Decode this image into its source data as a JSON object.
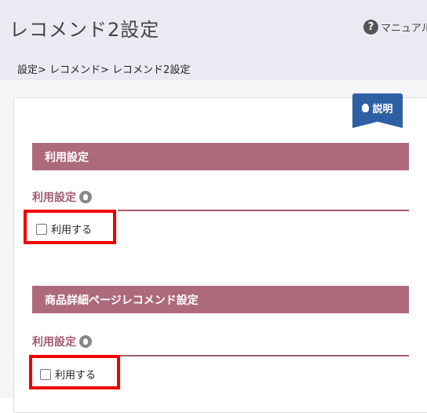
{
  "header": {
    "title": "レコメンド2設定",
    "manual_label": "マニュアル"
  },
  "breadcrumb": "設定> レコメンド> レコメンド2設定",
  "explain_tab": {
    "label": "説明"
  },
  "sections": [
    {
      "heading": "利用設定",
      "field_label": "利用設定",
      "checkbox_label": "利用する",
      "checked": false
    },
    {
      "heading": "商品詳細ページレコメンド設定",
      "field_label": "利用設定",
      "checkbox_label": "利用する",
      "checked": false
    }
  ],
  "colors": {
    "header_bg": "#ede9f2",
    "section_bg": "#ad6a7b",
    "label_color": "#a35a6d",
    "explain_bg": "#2d5fa5",
    "highlight": "#ee0000"
  }
}
